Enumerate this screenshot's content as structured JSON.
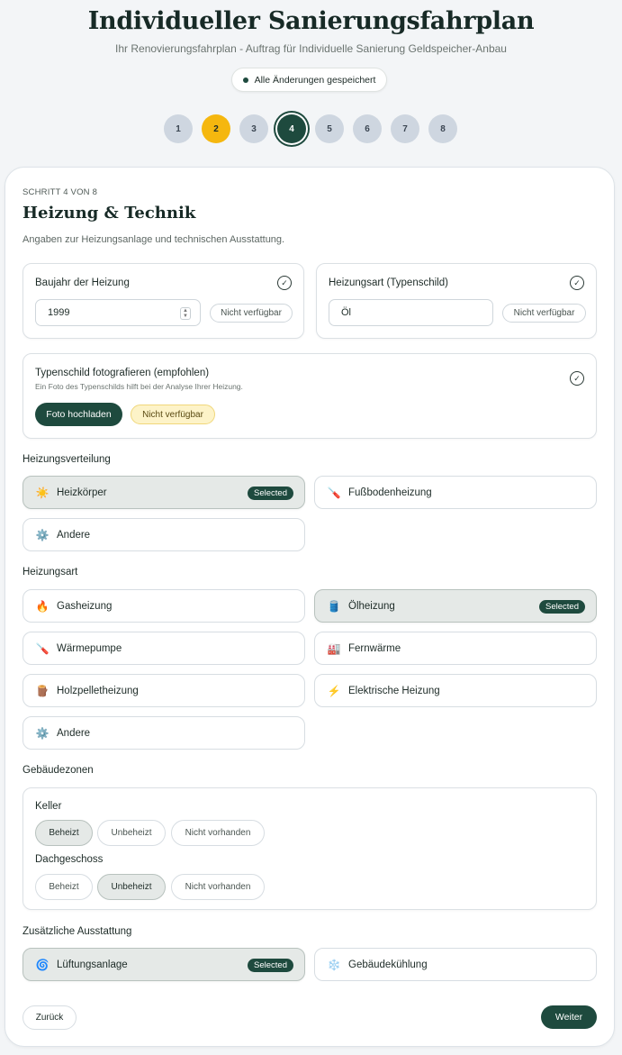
{
  "header": {
    "title": "Individueller Sanierungsfahrplan",
    "subtitle": "Ihr Renovierungsfahrplan - Auftrag für Individuelle Sanierung Geldspeicher-Anbau",
    "saved_status": "Alle Änderungen gespeichert"
  },
  "steps": [
    "1",
    "2",
    "3",
    "4",
    "5",
    "6",
    "7",
    "8"
  ],
  "step_state": {
    "done": "2",
    "active": "4"
  },
  "form": {
    "step_info": "SCHRITT 4 VON 8",
    "heading": "Heizung & Technik",
    "description": "Angaben zur Heizungsanlage und technischen Ausstattung.",
    "baujahr": {
      "label": "Baujahr der Heizung",
      "value": "1999",
      "na": "Nicht verfügbar"
    },
    "heizungsart_field": {
      "label": "Heizungsart (Typenschild)",
      "value": "Öl",
      "na": "Nicht verfügbar"
    },
    "typenschild": {
      "label": "Typenschild fotografieren (empfohlen)",
      "hint": "Ein Foto des Typenschilds hilft bei der Analyse Ihrer Heizung.",
      "upload": "Foto hochladen",
      "na": "Nicht verfügbar"
    },
    "selected_label": "Selected",
    "verteilung": {
      "title": "Heizungsverteilung",
      "options": [
        {
          "icon": "☀️",
          "icon_name": "radiator-icon",
          "label": "Heizkörper",
          "selected": true
        },
        {
          "icon": "🪛",
          "icon_name": "floor-heating-icon",
          "label": "Fußbodenheizung",
          "selected": false
        },
        {
          "icon": "⚙️",
          "icon_name": "gear-icon",
          "label": "Andere",
          "selected": false
        }
      ]
    },
    "heizungsart": {
      "title": "Heizungsart",
      "options": [
        {
          "icon": "🔥",
          "icon_name": "fire-icon",
          "label": "Gasheizung",
          "selected": false
        },
        {
          "icon": "🛢️",
          "icon_name": "oil-barrel-icon",
          "label": "Ölheizung",
          "selected": true
        },
        {
          "icon": "🪛",
          "icon_name": "heat-pump-icon",
          "label": "Wärmepumpe",
          "selected": false
        },
        {
          "icon": "🏭",
          "icon_name": "factory-icon",
          "label": "Fernwärme",
          "selected": false
        },
        {
          "icon": "🪵",
          "icon_name": "wood-icon",
          "label": "Holzpelletheizung",
          "selected": false
        },
        {
          "icon": "⚡",
          "icon_name": "lightning-icon",
          "label": "Elektrische Heizung",
          "selected": false
        },
        {
          "icon": "⚙️",
          "icon_name": "gear-icon",
          "label": "Andere",
          "selected": false
        }
      ]
    },
    "zonen": {
      "title": "Gebäudezonen",
      "keller": {
        "label": "Keller",
        "options": [
          "Beheizt",
          "Unbeheizt",
          "Nicht vorhanden"
        ],
        "selected": "Beheizt"
      },
      "dach": {
        "label": "Dachgeschoss",
        "options": [
          "Beheizt",
          "Unbeheizt",
          "Nicht vorhanden"
        ],
        "selected": "Unbeheizt"
      }
    },
    "ausstattung": {
      "title": "Zusätzliche Ausstattung",
      "options": [
        {
          "icon": "🌀",
          "icon_name": "ventilation-icon",
          "label": "Lüftungsanlage",
          "selected": true
        },
        {
          "icon": "❄️",
          "icon_name": "snowflake-icon",
          "label": "Gebäudekühlung",
          "selected": false
        }
      ]
    },
    "nav": {
      "back": "Zurück",
      "next": "Weiter"
    }
  },
  "colors": {
    "primary": "#1e4a3e",
    "accent": "#f5b70f",
    "inactive_step": "#ced6e0"
  }
}
